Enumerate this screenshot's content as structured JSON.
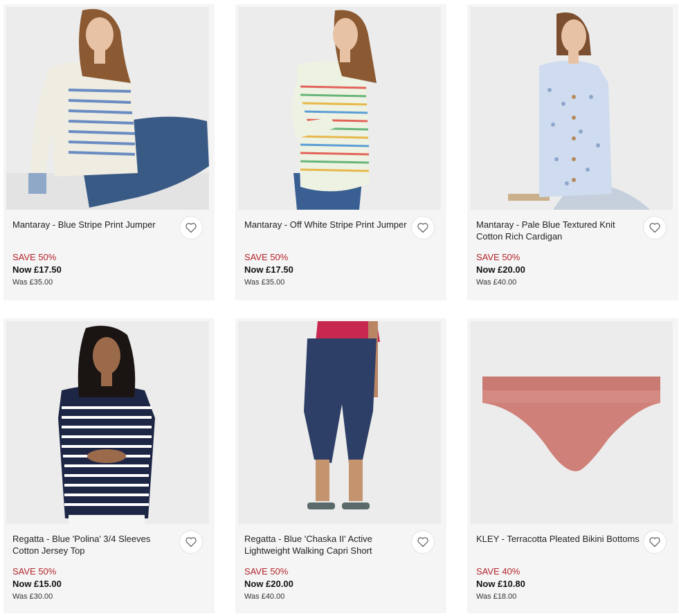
{
  "products": [
    {
      "title": "Mantaray - Blue Stripe Print Jumper",
      "save": "SAVE 50%",
      "now": "Now £17.50",
      "was": "Was £35.00",
      "image": "woman-blue-stripe-jumper"
    },
    {
      "title": "Mantaray - Off White Stripe Print Jumper",
      "save": "SAVE 50%",
      "now": "Now £17.50",
      "was": "Was £35.00",
      "image": "woman-rainbow-stripe-jumper"
    },
    {
      "title": "Mantaray - Pale Blue Textured Knit Cotton Rich Cardigan",
      "save": "SAVE 50%",
      "now": "Now £20.00",
      "was": "Was £40.00",
      "image": "woman-pale-blue-cardigan"
    },
    {
      "title": "Regatta - Blue 'Polina' 3/4 Sleeves Cotton Jersey Top",
      "save": "SAVE 50%",
      "now": "Now £15.00",
      "was": "Was £30.00",
      "image": "woman-navy-stripe-top"
    },
    {
      "title": "Regatta - Blue 'Chaska II' Active Lightweight Walking Capri Short",
      "save": "SAVE 50%",
      "now": "Now £20.00",
      "was": "Was £40.00",
      "image": "woman-navy-capri-shorts"
    },
    {
      "title": "KLEY - Terracotta Pleated Bikini Bottoms",
      "save": "SAVE 40%",
      "now": "Now £10.80",
      "was": "Was £18.00",
      "image": "terracotta-bikini-bottoms"
    }
  ],
  "colors": {
    "save": "#b4232a",
    "card_bg": "#f5f5f5",
    "image_bg": "#eeeeee"
  },
  "icons": {
    "wishlist": "heart-outline-icon"
  }
}
